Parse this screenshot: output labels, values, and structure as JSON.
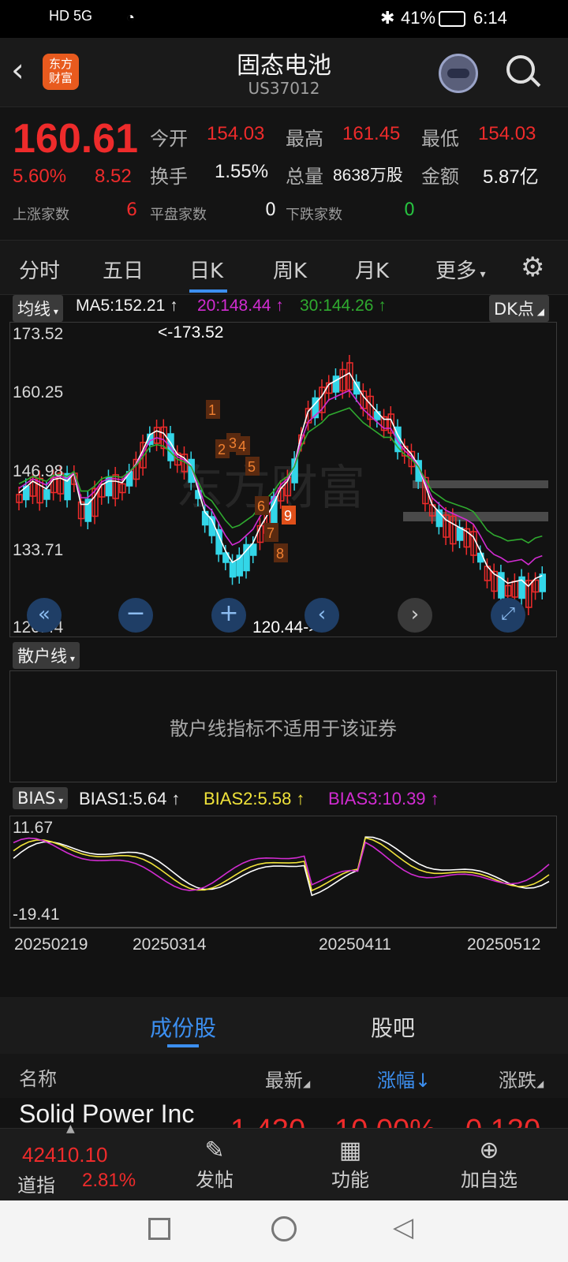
{
  "status_bar": {
    "left": "HD 5G",
    "battery": "41%",
    "time": "6:14"
  },
  "header": {
    "title": "固态电池",
    "code": "US37012",
    "logo": "东方财富",
    "logo_line1": "东方",
    "logo_line2": "财富"
  },
  "quote": {
    "price": "160.61",
    "change_pct": "5.60%",
    "change": "8.52",
    "open_label": "今开",
    "open": "154.03",
    "high_label": "最高",
    "high": "161.45",
    "low_label": "最低",
    "low": "154.03",
    "turnover_label": "换手",
    "turnover": "1.55%",
    "volume_label": "总量",
    "volume": "8638万股",
    "amount_label": "金额",
    "amount": "5.87亿",
    "up_label": "上涨家数",
    "up": "6",
    "flat_label": "平盘家数",
    "flat": "0",
    "down_label": "下跌家数",
    "down": "0"
  },
  "tabs": [
    "分时",
    "五日",
    "日K",
    "周K",
    "月K",
    "更多"
  ],
  "active_tab": "日K",
  "indicators": {
    "ma_chip": "均线",
    "ma5": "MA5:152.21",
    "ma20": "20:148.44",
    "ma30": "30:144.26",
    "dk_chip": "DK点",
    "retail_chip": "散户线",
    "retail_msg": "散户线指标不适用于该证券",
    "bias_chip": "BIAS",
    "bias1": "BIAS1:5.64",
    "bias2": "BIAS2:5.58",
    "bias3": "BIAS3:10.39"
  },
  "chart_data": {
    "type": "candlestick",
    "y_ticks": [
      "173.52",
      "160.25",
      "146.98",
      "133.71",
      "120.44"
    ],
    "high_marker": "<-173.52",
    "low_marker": "120.44->",
    "bias_ticks": [
      "11.67",
      "-19.41"
    ],
    "x_ticks": [
      "20250219",
      "20250314",
      "20250411",
      "20250512"
    ],
    "watermark": "东方财富",
    "countdown_labels": [
      "1",
      "2",
      "3",
      "4",
      "5",
      "6",
      "7",
      "8",
      "9"
    ],
    "colors": {
      "up": "#ee2b2b",
      "down": "#33d6e8",
      "ma5": "#ffffff",
      "ma20": "#d22cd2",
      "ma30": "#2faa2f",
      "bias2": "#f0e33a"
    }
  },
  "bottom_tabs": [
    "成份股",
    "股吧"
  ],
  "list_head": {
    "name": "名称",
    "latest": "最新",
    "change_pct": "涨幅↓",
    "change": "涨跌"
  },
  "list_row": {
    "name": "Solid Power Inc",
    "latest": "1.430",
    "pct": "10.00%",
    "chg": "0.130"
  },
  "bottom_nav": {
    "index_value": "42410.10",
    "index_name": "道指",
    "index_pct": "2.81%",
    "post": "发帖",
    "func": "功能",
    "add": "加自选"
  }
}
